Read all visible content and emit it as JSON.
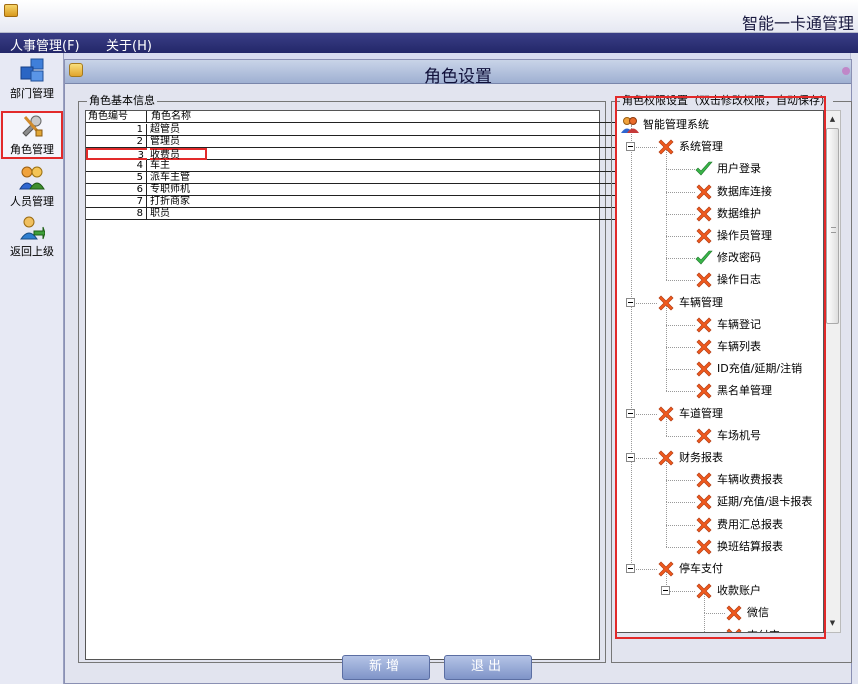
{
  "window": {
    "title": "智能一卡通管理"
  },
  "menu": [
    "人事管理(F)",
    "关于(H)"
  ],
  "leftnav": [
    {
      "label": "部门管理",
      "icon": "department-icon"
    },
    {
      "label": "角色管理",
      "icon": "tools-icon",
      "selected": true
    },
    {
      "label": "人员管理",
      "icon": "people-icon"
    },
    {
      "label": "返回上级",
      "icon": "return-icon"
    }
  ],
  "panel": {
    "title": "角色设置"
  },
  "role_group": {
    "legend": "角色基本信息",
    "columns": [
      "角色编号",
      "角色名称"
    ],
    "rows": [
      {
        "id": "1",
        "name": "超管员"
      },
      {
        "id": "2",
        "name": "管理员"
      },
      {
        "id": "3",
        "name": "收费员",
        "selected": true
      },
      {
        "id": "4",
        "name": "车主"
      },
      {
        "id": "5",
        "name": "派车主管"
      },
      {
        "id": "6",
        "name": "专职师机"
      },
      {
        "id": "7",
        "name": "打折商家"
      },
      {
        "id": "8",
        "name": "职员"
      }
    ]
  },
  "perm_group": {
    "legend": "角色权限设置（双击修改权限，自动保存）",
    "tree": [
      {
        "label": "智能管理系统",
        "level": 0,
        "icon": "users-icon"
      },
      {
        "label": "系统管理",
        "level": 1,
        "icon": "cross-icon",
        "expander": true
      },
      {
        "label": "用户登录",
        "level": 2,
        "icon": "check-icon"
      },
      {
        "label": "数据库连接",
        "level": 2,
        "icon": "cross-icon"
      },
      {
        "label": "数据维护",
        "level": 2,
        "icon": "cross-icon"
      },
      {
        "label": "操作员管理",
        "level": 2,
        "icon": "cross-icon"
      },
      {
        "label": "修改密码",
        "level": 2,
        "icon": "check-icon"
      },
      {
        "label": "操作日志",
        "level": 2,
        "icon": "cross-icon"
      },
      {
        "label": "车辆管理",
        "level": 1,
        "icon": "cross-icon",
        "expander": true
      },
      {
        "label": "车辆登记",
        "level": 2,
        "icon": "cross-icon"
      },
      {
        "label": "车辆列表",
        "level": 2,
        "icon": "cross-icon"
      },
      {
        "label": "ID充值/延期/注销",
        "level": 2,
        "icon": "cross-icon"
      },
      {
        "label": "黑名单管理",
        "level": 2,
        "icon": "cross-icon"
      },
      {
        "label": "车道管理",
        "level": 1,
        "icon": "cross-icon",
        "expander": true
      },
      {
        "label": "车场机号",
        "level": 2,
        "icon": "cross-icon"
      },
      {
        "label": "财务报表",
        "level": 1,
        "icon": "cross-icon",
        "expander": true
      },
      {
        "label": "车辆收费报表",
        "level": 2,
        "icon": "cross-icon"
      },
      {
        "label": "延期/充值/退卡报表",
        "level": 2,
        "icon": "cross-icon"
      },
      {
        "label": "费用汇总报表",
        "level": 2,
        "icon": "cross-icon"
      },
      {
        "label": "换班结算报表",
        "level": 2,
        "icon": "cross-icon"
      },
      {
        "label": "停车支付",
        "level": 1,
        "icon": "cross-icon",
        "expander": true
      },
      {
        "label": "收款账户",
        "level": 2,
        "icon": "cross-icon",
        "expander": true
      },
      {
        "label": "微信",
        "level": 3,
        "icon": "cross-icon"
      },
      {
        "label": "支付宝",
        "level": 3,
        "icon": "cross-icon"
      }
    ]
  },
  "buttons": {
    "add": "新增",
    "exit": "退出"
  },
  "colors": {
    "highlight": "#e22a2a",
    "menubar": "#2d3178",
    "check": "#39b54a",
    "cross": "#f05a1e"
  }
}
